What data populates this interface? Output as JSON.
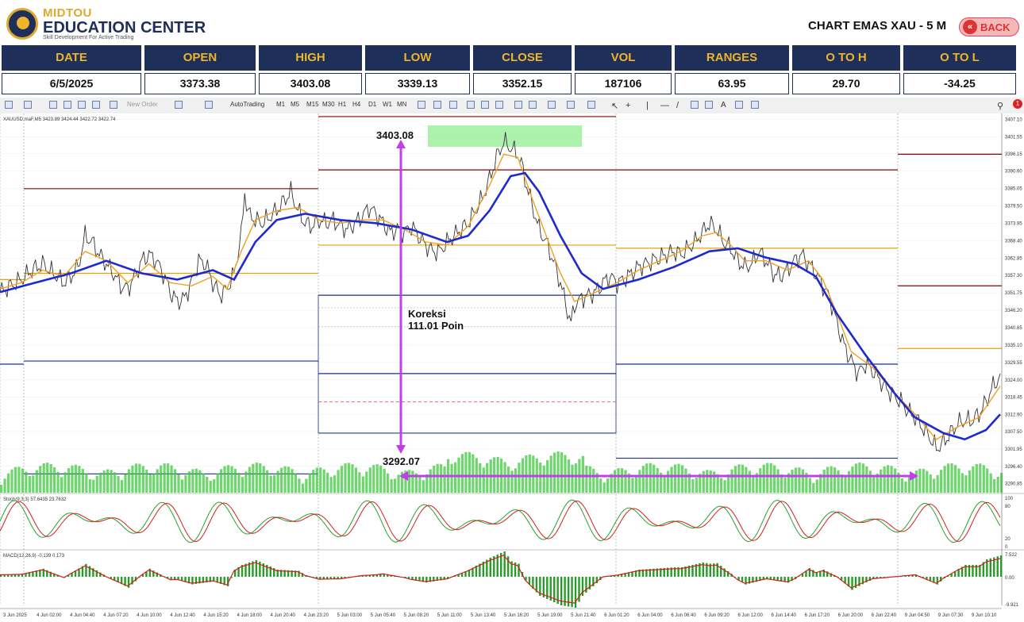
{
  "header": {
    "logo_line1": "MIDTOU",
    "logo_line2": "EDUCATION CENTER",
    "logo_line3": "Skill Development For Active Trading",
    "title": "CHART EMAS XAU - 5 M",
    "back_label": "BACK"
  },
  "stats": [
    {
      "label": "DATE",
      "value": "6/5/2025"
    },
    {
      "label": "OPEN",
      "value": "3373.38"
    },
    {
      "label": "HIGH",
      "value": "3403.08"
    },
    {
      "label": "LOW",
      "value": "3339.13"
    },
    {
      "label": "CLOSE",
      "value": "3352.15"
    },
    {
      "label": "VOL",
      "value": "187106"
    },
    {
      "label": "RANGES",
      "value": "63.95"
    },
    {
      "label": "O TO H",
      "value": "29.70"
    },
    {
      "label": "O TO L",
      "value": "-34.25"
    }
  ],
  "toolbar": {
    "new_order": "New Order",
    "autotrading": "AutoTrading",
    "timeframes": [
      "M1",
      "M5",
      "M15",
      "M30",
      "H1",
      "H4",
      "D1",
      "W1",
      "MN"
    ]
  },
  "colors": {
    "navy": "#1e2f5a",
    "gold": "#f0b429",
    "price": "#333333",
    "ema_fast": "#f0a020",
    "ema_slow": "#1e2ad0",
    "volume": "#3cc83c",
    "annotation": "#c040e8"
  },
  "chart_data": {
    "type": "line",
    "instrument_label": "XAUUSD.maF,M5  3423.89 3424.44 3422.72 3422.74",
    "y_ticks": [
      "3407.10",
      "3401.55",
      "3396.15",
      "3390.60",
      "3385.05",
      "3379.50",
      "3373.95",
      "3368.40",
      "3362.85",
      "3357.30",
      "3351.75",
      "3346.20",
      "3340.65",
      "3335.10",
      "3329.55",
      "3324.00",
      "3318.45",
      "3312.90",
      "3307.50",
      "3301.95",
      "3296.40",
      "3290.85"
    ],
    "ylim": [
      3288,
      3409
    ],
    "x_ticks": [
      "3 Jun 2025",
      "4 Jun 02:00",
      "4 Jun 04:40",
      "4 Jun 07:20",
      "4 Jun 10:00",
      "4 Jun 12:40",
      "4 Jun 15:20",
      "4 Jun 18:00",
      "4 Jun 20:40",
      "4 Jun 23:20",
      "5 Jun 03:00",
      "5 Jun 05:40",
      "5 Jun 08:20",
      "5 Jun 11:00",
      "5 Jun 13:40",
      "5 Jun 16:20",
      "5 Jun 19:00",
      "5 Jun 21:40",
      "6 Jun 01:20",
      "6 Jun 04:00",
      "6 Jun 06:40",
      "6 Jun 09:20",
      "6 Jun 12:00",
      "6 Jun 14:40",
      "6 Jun 17:20",
      "6 Jun 20:00",
      "6 Jun 22:40",
      "9 Jun 04:50",
      "9 Jun 07:30",
      "9 Jun 10:10"
    ],
    "price_series": [
      [
        0,
        3352
      ],
      [
        3,
        3354
      ],
      [
        6,
        3356
      ],
      [
        9,
        3359
      ],
      [
        12,
        3361
      ],
      [
        15,
        3358
      ],
      [
        18,
        3355
      ],
      [
        20,
        3357
      ],
      [
        22,
        3360
      ],
      [
        24,
        3370
      ],
      [
        26,
        3368
      ],
      [
        28,
        3364
      ],
      [
        30,
        3361
      ],
      [
        32,
        3358
      ],
      [
        34,
        3354
      ],
      [
        36,
        3353
      ],
      [
        38,
        3357
      ],
      [
        40,
        3362
      ],
      [
        42,
        3364
      ],
      [
        44,
        3362
      ],
      [
        46,
        3358
      ],
      [
        48,
        3352
      ],
      [
        50,
        3349
      ],
      [
        52,
        3350
      ],
      [
        54,
        3355
      ],
      [
        56,
        3362
      ],
      [
        58,
        3361
      ],
      [
        60,
        3355
      ],
      [
        62,
        3351
      ],
      [
        64,
        3353
      ],
      [
        66,
        3358
      ],
      [
        68,
        3370
      ],
      [
        69,
        3384
      ],
      [
        70,
        3377
      ],
      [
        72,
        3375
      ],
      [
        74,
        3374
      ],
      [
        76,
        3376
      ],
      [
        78,
        3378
      ],
      [
        80,
        3381
      ],
      [
        82,
        3384
      ],
      [
        84,
        3378
      ],
      [
        86,
        3374
      ],
      [
        88,
        3373
      ],
      [
        90,
        3375
      ],
      [
        92,
        3374
      ],
      [
        94,
        3375
      ],
      [
        96,
        3373
      ],
      [
        98,
        3372
      ],
      [
        100,
        3374
      ],
      [
        102,
        3376
      ],
      [
        104,
        3379
      ],
      [
        106,
        3377
      ],
      [
        108,
        3374
      ],
      [
        110,
        3371
      ],
      [
        112,
        3372
      ],
      [
        114,
        3371
      ],
      [
        116,
        3373
      ],
      [
        118,
        3370
      ],
      [
        120,
        3367
      ],
      [
        122,
        3365
      ],
      [
        124,
        3365
      ],
      [
        126,
        3368
      ],
      [
        128,
        3370
      ],
      [
        130,
        3372
      ],
      [
        132,
        3374
      ],
      [
        134,
        3378
      ],
      [
        136,
        3382
      ],
      [
        138,
        3388
      ],
      [
        140,
        3395
      ],
      [
        142,
        3400
      ],
      [
        144,
        3398
      ],
      [
        146,
        3396
      ],
      [
        147,
        3393
      ],
      [
        148,
        3388
      ],
      [
        150,
        3380
      ],
      [
        152,
        3372
      ],
      [
        154,
        3368
      ],
      [
        156,
        3362
      ],
      [
        158,
        3355
      ],
      [
        160,
        3346
      ],
      [
        161,
        3342
      ],
      [
        162,
        3348
      ],
      [
        164,
        3350
      ],
      [
        166,
        3351
      ],
      [
        168,
        3352
      ],
      [
        170,
        3355
      ],
      [
        172,
        3357
      ],
      [
        174,
        3355
      ],
      [
        176,
        3356
      ],
      [
        178,
        3358
      ],
      [
        180,
        3360
      ],
      [
        182,
        3361
      ],
      [
        184,
        3362
      ],
      [
        186,
        3363
      ],
      [
        188,
        3364
      ],
      [
        190,
        3365
      ],
      [
        192,
        3364
      ],
      [
        194,
        3366
      ],
      [
        196,
        3368
      ],
      [
        198,
        3371
      ],
      [
        200,
        3374
      ],
      [
        202,
        3372
      ],
      [
        204,
        3368
      ],
      [
        206,
        3366
      ],
      [
        208,
        3362
      ],
      [
        210,
        3360
      ],
      [
        212,
        3361
      ],
      [
        214,
        3365
      ],
      [
        216,
        3362
      ],
      [
        218,
        3358
      ],
      [
        220,
        3357
      ],
      [
        222,
        3359
      ],
      [
        224,
        3362
      ],
      [
        226,
        3364
      ],
      [
        228,
        3361
      ],
      [
        230,
        3358
      ],
      [
        232,
        3354
      ],
      [
        234,
        3350
      ],
      [
        236,
        3342
      ],
      [
        238,
        3335
      ],
      [
        240,
        3330
      ],
      [
        242,
        3326
      ],
      [
        244,
        3329
      ],
      [
        246,
        3327
      ],
      [
        248,
        3324
      ],
      [
        250,
        3321
      ],
      [
        252,
        3319
      ],
      [
        254,
        3317
      ],
      [
        256,
        3314
      ],
      [
        258,
        3312
      ],
      [
        260,
        3309
      ],
      [
        262,
        3306
      ],
      [
        264,
        3302
      ],
      [
        266,
        3304
      ],
      [
        268,
        3307
      ],
      [
        270,
        3310
      ],
      [
        272,
        3311
      ],
      [
        274,
        3311
      ],
      [
        276,
        3313
      ],
      [
        278,
        3317
      ],
      [
        280,
        3322
      ],
      [
        282,
        3325
      ]
    ],
    "ema_fast_series": [
      [
        0,
        3353
      ],
      [
        6,
        3355
      ],
      [
        12,
        3359
      ],
      [
        18,
        3357
      ],
      [
        24,
        3365
      ],
      [
        30,
        3362
      ],
      [
        36,
        3355
      ],
      [
        42,
        3361
      ],
      [
        48,
        3355
      ],
      [
        54,
        3354
      ],
      [
        60,
        3357
      ],
      [
        64,
        3353
      ],
      [
        68,
        3365
      ],
      [
        72,
        3375
      ],
      [
        78,
        3378
      ],
      [
        84,
        3379
      ],
      [
        90,
        3375
      ],
      [
        96,
        3374
      ],
      [
        102,
        3375
      ],
      [
        108,
        3375
      ],
      [
        114,
        3372
      ],
      [
        120,
        3368
      ],
      [
        126,
        3367
      ],
      [
        132,
        3373
      ],
      [
        138,
        3386
      ],
      [
        142,
        3396
      ],
      [
        146,
        3395
      ],
      [
        150,
        3382
      ],
      [
        154,
        3370
      ],
      [
        158,
        3358
      ],
      [
        162,
        3349
      ],
      [
        168,
        3352
      ],
      [
        174,
        3355
      ],
      [
        180,
        3359
      ],
      [
        186,
        3362
      ],
      [
        192,
        3365
      ],
      [
        198,
        3370
      ],
      [
        202,
        3371
      ],
      [
        206,
        3367
      ],
      [
        210,
        3362
      ],
      [
        216,
        3362
      ],
      [
        222,
        3359
      ],
      [
        228,
        3362
      ],
      [
        232,
        3356
      ],
      [
        236,
        3345
      ],
      [
        240,
        3333
      ],
      [
        246,
        3328
      ],
      [
        252,
        3320
      ],
      [
        258,
        3313
      ],
      [
        264,
        3305
      ],
      [
        270,
        3309
      ],
      [
        276,
        3312
      ],
      [
        282,
        3322
      ]
    ],
    "ema_slow_series": [
      [
        0,
        3352
      ],
      [
        10,
        3355
      ],
      [
        20,
        3358
      ],
      [
        30,
        3362
      ],
      [
        40,
        3358
      ],
      [
        50,
        3356
      ],
      [
        60,
        3359
      ],
      [
        66,
        3356
      ],
      [
        72,
        3368
      ],
      [
        78,
        3375
      ],
      [
        86,
        3377
      ],
      [
        96,
        3375
      ],
      [
        106,
        3374
      ],
      [
        116,
        3372
      ],
      [
        126,
        3368
      ],
      [
        132,
        3370
      ],
      [
        138,
        3378
      ],
      [
        144,
        3389
      ],
      [
        148,
        3390
      ],
      [
        152,
        3384
      ],
      [
        158,
        3370
      ],
      [
        164,
        3358
      ],
      [
        170,
        3353
      ],
      [
        180,
        3356
      ],
      [
        190,
        3360
      ],
      [
        200,
        3365
      ],
      [
        208,
        3366
      ],
      [
        216,
        3363
      ],
      [
        224,
        3361
      ],
      [
        230,
        3357
      ],
      [
        236,
        3345
      ],
      [
        244,
        3332
      ],
      [
        252,
        3320
      ],
      [
        258,
        3312
      ],
      [
        266,
        3307
      ],
      [
        272,
        3305
      ],
      [
        278,
        3308
      ],
      [
        282,
        3313
      ]
    ],
    "annotations": [
      {
        "text": "3403.08",
        "value": 3403.08
      },
      {
        "text": "3292.07",
        "value": 3292.07
      },
      {
        "text": "Koreksi",
        "line2": "111.01 Poin"
      }
    ],
    "stoch_label": "Stoch(9,3,3) 57.6435 23.7632",
    "stoch_ticks": [
      "100",
      "80",
      "20",
      "0"
    ],
    "macd_label": "MACD(12,26,9) -0.139 0.173",
    "macd_ticks": [
      "7.522",
      "0.00",
      "-9.921"
    ]
  }
}
